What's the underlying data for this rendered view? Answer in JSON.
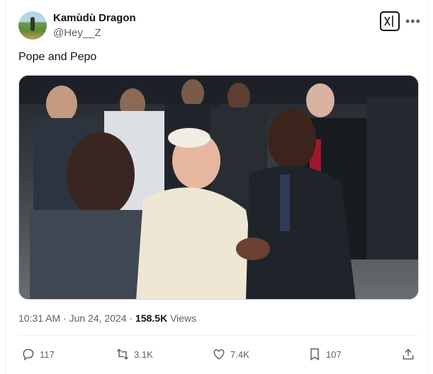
{
  "author": {
    "display_name": "Kamùdù Dragon",
    "handle": "@Hey__Z"
  },
  "tweet": {
    "text": "Pope and Pepo",
    "time": "10:31 AM",
    "separator": "·",
    "date": "Jun 24, 2024",
    "views_count": "158.5K",
    "views_label": "Views"
  },
  "actions": {
    "replies": "117",
    "reposts": "3.1K",
    "likes": "7.4K",
    "bookmarks": "107"
  },
  "icons": [
    "grok-icon",
    "more-icon",
    "reply-icon",
    "repost-icon",
    "like-icon",
    "bookmark-icon",
    "share-icon"
  ],
  "colors": {
    "text": "#0f1419",
    "secondary": "#536471",
    "border": "#eff3f4"
  }
}
